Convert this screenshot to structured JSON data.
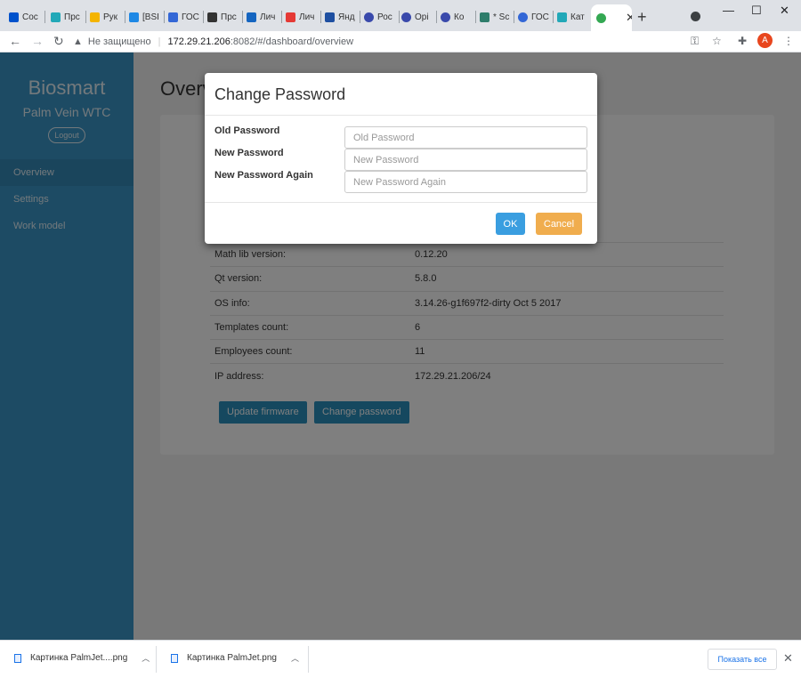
{
  "browser": {
    "tabs": [
      {
        "label": "Coc",
        "color": "#0052cc"
      },
      {
        "label": "Прс",
        "color": "#22a8b8"
      },
      {
        "label": "Рук",
        "color": "#f4b400"
      },
      {
        "label": "[BSI",
        "color": "#1e88e5"
      },
      {
        "label": "ГОС",
        "color": "#3367d6"
      },
      {
        "label": "Прс",
        "color": "#333333"
      },
      {
        "label": "Лич",
        "color": "#1565c0"
      },
      {
        "label": "Лич",
        "color": "#e53935"
      },
      {
        "label": "Янд",
        "color": "#1e4fa1"
      },
      {
        "label": "Рос",
        "color": "#3949ab"
      },
      {
        "label": "Орі",
        "color": "#3949ab"
      },
      {
        "label": "Ко",
        "color": "#3949ab"
      },
      {
        "label": "* Sc",
        "color": "#2e7d6b"
      },
      {
        "label": "ГОС",
        "color": "#3367d6"
      },
      {
        "label": "Кат",
        "color": "#22a8b8"
      }
    ],
    "active_tab_color": "#34a853",
    "address": {
      "insecure_label": "Не защищено",
      "host": "172.29.21.206",
      "path": ":8082/#/dashboard/overview"
    },
    "profile_initial": "A"
  },
  "sidebar": {
    "brand": "Biosmart",
    "subbrand": "Palm Vein WTC",
    "logout": "Logout",
    "items": [
      {
        "label": "Overview"
      },
      {
        "label": "Settings"
      },
      {
        "label": "Work model"
      }
    ]
  },
  "content": {
    "title": "Overview",
    "rows": [
      {
        "key": "Math lib version:",
        "value": "0.12.20"
      },
      {
        "key": "Qt version:",
        "value": "5.8.0"
      },
      {
        "key": "OS info:",
        "value": "3.14.26-g1f697f2-dirty Oct 5 2017"
      },
      {
        "key": "Templates count:",
        "value": "6"
      },
      {
        "key": "Employees count:",
        "value": "11"
      },
      {
        "key": "IP address:",
        "value": "172.29.21.206/24"
      }
    ],
    "update_firmware": "Update firmware",
    "change_password": "Change password"
  },
  "modal": {
    "title": "Change Password",
    "fields": [
      {
        "label": "Old Password",
        "placeholder": "Old Password"
      },
      {
        "label": "New Password",
        "placeholder": "New Password"
      },
      {
        "label": "New Password Again",
        "placeholder": "New Password Again"
      }
    ],
    "ok": "OK",
    "cancel": "Cancel"
  },
  "downloads": {
    "items": [
      {
        "name": "Картинка PalmJet....png"
      },
      {
        "name": "Картинка PalmJet.png"
      }
    ],
    "show_all": "Показать все"
  }
}
